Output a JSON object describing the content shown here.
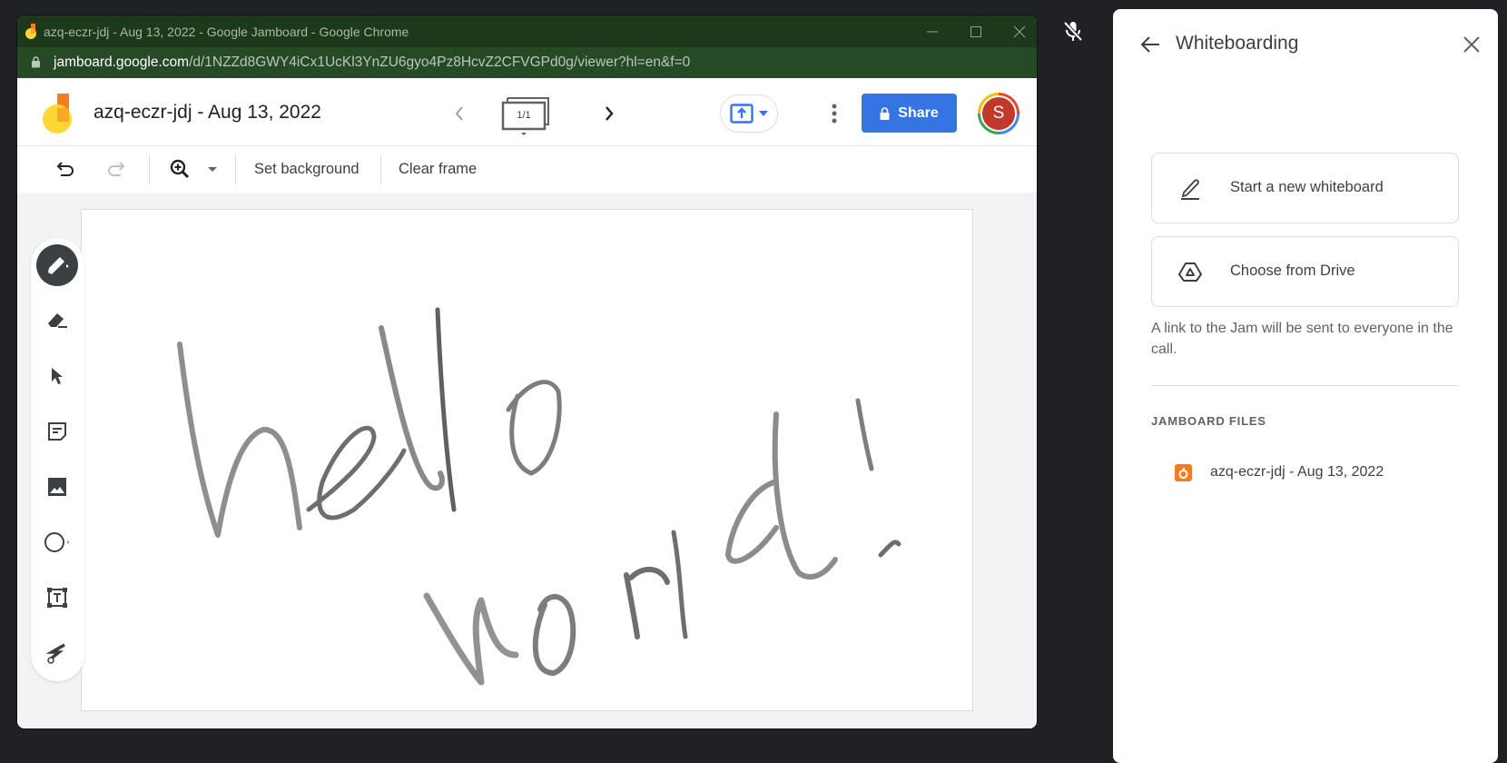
{
  "browser": {
    "window_title": "azq-eczr-jdj - Aug 13, 2022 - Google Jamboard - Google Chrome",
    "url_host": "jamboard.google.com",
    "url_path": "/d/1NZZd8GWY4iCx1UcKl3YnZU6gyo4Pz8HcvZ2CFVGPd0g/viewer?hl=en&f=0",
    "controls": [
      "minimize-icon",
      "maximize-icon",
      "close-icon"
    ]
  },
  "jamboard": {
    "doc_title": "azq-eczr-jdj - Aug 13, 2022",
    "frame_indicator": "1/1",
    "share_label": "Share",
    "avatar_initial": "S",
    "toolbar": {
      "undo": "undo-icon",
      "redo": "redo-icon",
      "zoom": "zoom-in-icon",
      "set_background": "Set background",
      "clear_frame": "Clear frame"
    },
    "tools": [
      {
        "name": "pen",
        "icon": "pen-icon",
        "active": true
      },
      {
        "name": "eraser",
        "icon": "eraser-icon",
        "active": false
      },
      {
        "name": "select",
        "icon": "cursor-icon",
        "active": false
      },
      {
        "name": "sticky-note",
        "icon": "sticky-note-icon",
        "active": false
      },
      {
        "name": "image",
        "icon": "image-icon",
        "active": false
      },
      {
        "name": "shape",
        "icon": "circle-icon",
        "active": false
      },
      {
        "name": "text-box",
        "icon": "text-box-icon",
        "active": false
      },
      {
        "name": "laser",
        "icon": "laser-icon",
        "active": false
      }
    ],
    "canvas_handwriting": "hello world!",
    "colors": {
      "share_blue": "#3574e3",
      "logo_orange": "#f57c1f",
      "logo_yellow": "#fdd835"
    }
  },
  "meet": {
    "mic_state": "muted"
  },
  "panel": {
    "title": "Whiteboarding",
    "options": [
      {
        "label": "Start a new whiteboard",
        "icon": "pencil-icon"
      },
      {
        "label": "Choose from Drive",
        "icon": "drive-icon"
      }
    ],
    "note": "A link to the Jam will be sent to everyone in the call.",
    "files_heading": "JAMBOARD FILES",
    "files": [
      {
        "label": "azq-eczr-jdj - Aug 13, 2022",
        "icon": "jamboard-file-icon"
      }
    ]
  }
}
